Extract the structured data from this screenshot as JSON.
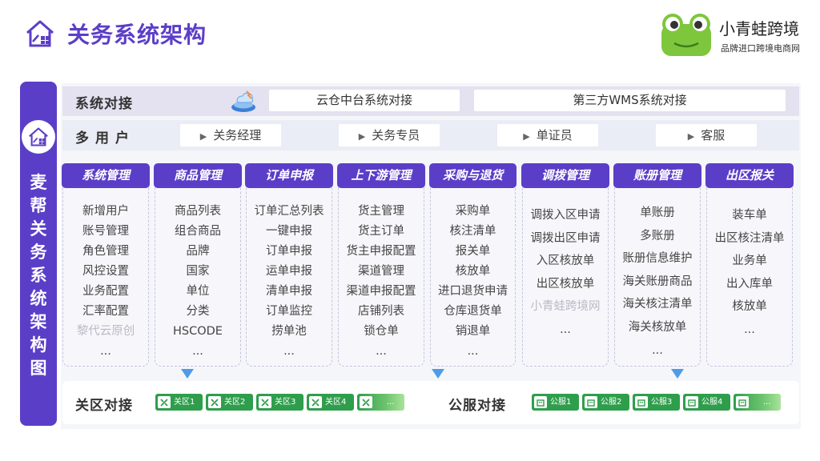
{
  "header": {
    "title": "关务系统架构",
    "brand_name": "小青蛙跨境",
    "brand_sub": "品牌进口跨境电商网"
  },
  "side_title": [
    "麦",
    "帮",
    "关",
    "务",
    "系",
    "统",
    "架",
    "构",
    "图"
  ],
  "row_system": {
    "label": "系统对接",
    "boxes": [
      "云仓中台系统对接",
      "第三方WMS系统对接"
    ]
  },
  "row_users": {
    "label": "多用户",
    "users": [
      "关务经理",
      "关务专员",
      "单证员",
      "客服"
    ]
  },
  "columns": [
    {
      "title": "系统管理",
      "items": [
        "新增用户",
        "账号管理",
        "角色管理",
        "风控设置",
        "业务配置",
        "汇率配置",
        "黎代云原创",
        "..."
      ]
    },
    {
      "title": "商品管理",
      "items": [
        "商品列表",
        "组合商品",
        "品牌",
        "国家",
        "单位",
        "分类",
        "HSCODE",
        "..."
      ]
    },
    {
      "title": "订单申报",
      "items": [
        "订单汇总列表",
        "一键申报",
        "订单申报",
        "运单申报",
        "清单申报",
        "订单监控",
        "捞单池",
        "..."
      ]
    },
    {
      "title": "上下游管理",
      "items": [
        "货主管理",
        "货主订单",
        "货主申报配置",
        "渠道管理",
        "渠道申报配置",
        "店铺列表",
        "锁仓单",
        "..."
      ]
    },
    {
      "title": "采购与退货",
      "items": [
        "采购单",
        "核注清单",
        "报关单",
        "核放单",
        "进口退货申请",
        "仓库退货单",
        "销退单",
        "..."
      ]
    },
    {
      "title": "调拨管理",
      "items": [
        "调拨入区申请",
        "调拨出区申请",
        "入区核放单",
        "出区核放单",
        "小青蛙跨境网",
        "..."
      ]
    },
    {
      "title": "账册管理",
      "items": [
        "单账册",
        "多账册",
        "账册信息维护",
        "海关账册商品",
        "海关核注清单",
        "海关核放单",
        "..."
      ]
    },
    {
      "title": "出区报关",
      "items": [
        "装车单",
        "出区核注清单",
        "业务单",
        "出入库单",
        "核放单",
        "..."
      ]
    }
  ],
  "row_bottom": {
    "zone_label": "关区对接",
    "zones": [
      "关区1",
      "关区2",
      "关区3",
      "关区4",
      "..."
    ],
    "public_label": "公服对接",
    "publics": [
      "公服1",
      "公服2",
      "公服3",
      "公服4",
      "..."
    ]
  },
  "colors": {
    "accent": "#5b3ec8",
    "green": "#2f9e4c",
    "arrow": "#4f9be6"
  }
}
